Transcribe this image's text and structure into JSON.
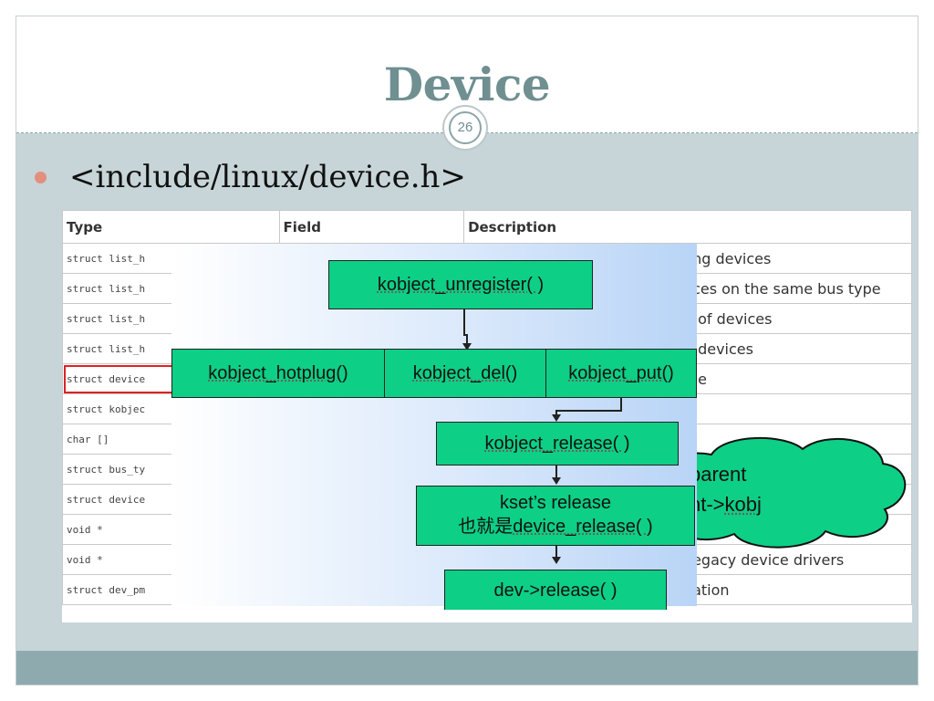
{
  "slide": {
    "title": "Device",
    "page_number": "26",
    "bullet": "<include/linux/device.h>"
  },
  "table": {
    "headers": [
      "Type",
      "Field",
      "Description"
    ],
    "rows": [
      {
        "type": "struct list_h",
        "field": "",
        "desc": "ng devices"
      },
      {
        "type": "struct list_h",
        "field": "",
        "desc": "ces on the same bus type"
      },
      {
        "type": "struct list_h",
        "field": "",
        "desc": "of devices"
      },
      {
        "type": "struct list_h",
        "field": "",
        "desc": "devices"
      },
      {
        "type": "struct device",
        "field": "",
        "desc": "e",
        "highlight": true
      },
      {
        "type": "struct kobjec",
        "field": "",
        "desc": ""
      },
      {
        "type": "char []",
        "field": "",
        "desc": ""
      },
      {
        "type": "struct bus_ty",
        "field": "",
        "desc": ""
      },
      {
        "type": "struct device",
        "field": "",
        "desc": ""
      },
      {
        "type": "void *",
        "field": "",
        "desc": ""
      },
      {
        "type": "void *",
        "field": "",
        "desc": "egacy device drivers"
      },
      {
        "type": "struct dev_pm",
        "field": "",
        "desc": "ation"
      }
    ]
  },
  "diagram": {
    "unregister": "kobject_unregister( )",
    "hotplug": "kobject_hotplug()",
    "del": "kobject_del()",
    "put": "kobject_put()",
    "release": "kobject_release( )",
    "kset_line1": "kset’s release",
    "kset_line2_prefix": "也就是",
    "kset_line2_func": "device_release( )",
    "dev_release": "dev->release( )",
    "cloud_line1": "parent",
    "cloud_line2_prefix": "nt->",
    "cloud_line2_func": "kobj"
  },
  "colors": {
    "title": "#6f8f91",
    "content_bg": "#c7d5d8",
    "footer_bg": "#8eaaaf",
    "bullet": "#e38e7e",
    "box_green": "#0dcf86"
  }
}
